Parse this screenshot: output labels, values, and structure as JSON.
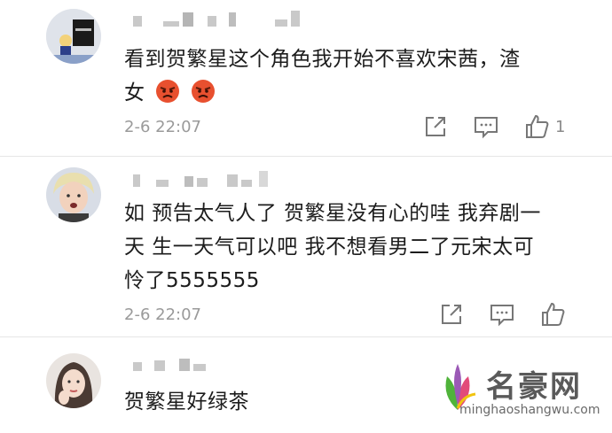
{
  "comments": [
    {
      "text_line1": "看到贺繁星这个角色我开始不喜欢宋茜，渣",
      "text_line2": "女",
      "time": "2-6 22:07",
      "like_count": "1",
      "emoji": "angry-face-icon"
    },
    {
      "text_line1": "如  预告太气人了 贺繁星没有心的哇 我弃剧一",
      "text_line2": "天 生一天气可以吧 我不想看男二了元宋太可",
      "text_line3": "怜了5555555",
      "time": "2-6 22:07"
    },
    {
      "text_line1": "贺繁星好绿茶"
    }
  ],
  "icons": {
    "share": "share-icon",
    "comment": "comment-icon",
    "like": "like-icon"
  },
  "watermark": {
    "cn": "名豪网",
    "en": "minghaoshangwu.com"
  },
  "colors": {
    "time": "#9a9a9a",
    "text": "#1c1c1c",
    "mosaic": "#c9c9c9"
  }
}
